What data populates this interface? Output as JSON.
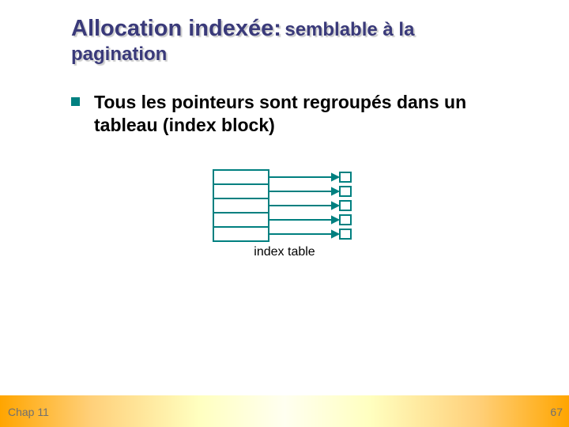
{
  "title": {
    "main": "Allocation indexée:",
    "sub": "semblable à la",
    "line2": "pagination"
  },
  "body": {
    "bullet1": "Tous les pointeurs sont regroupés dans un tableau (index block)"
  },
  "diagram": {
    "caption": "index table"
  },
  "footer": {
    "left": "Chap 11",
    "right": "67"
  }
}
